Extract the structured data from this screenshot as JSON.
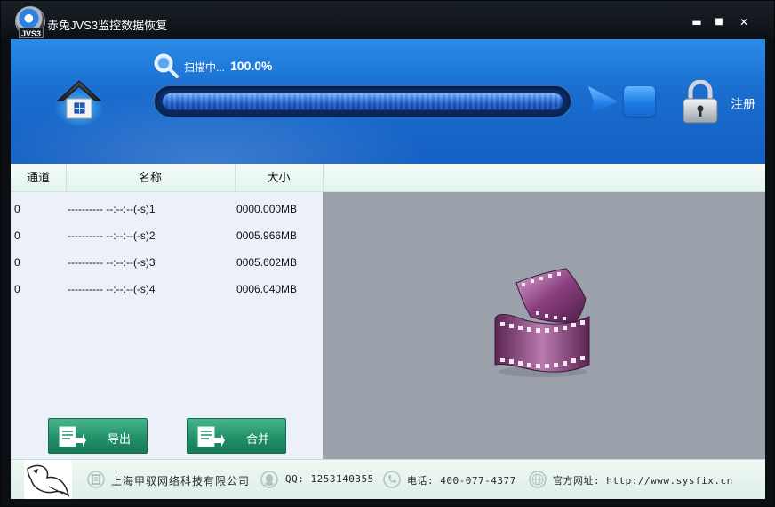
{
  "window": {
    "title": "赤兔JVS3监控数据恢复",
    "logo_tag": "JVS3",
    "minimize": "▬",
    "maximize": "■",
    "close": "✕"
  },
  "scan": {
    "label": "扫描中...",
    "percent_text": "100.0%",
    "progress_fraction": 1.0
  },
  "header": {
    "register_label": "注册"
  },
  "list": {
    "columns": [
      "通道",
      "名称",
      "大小"
    ],
    "rows": [
      {
        "channel": "0",
        "name": "---------- --:--:--(-s)1",
        "size": "0000.000MB"
      },
      {
        "channel": "0",
        "name": "---------- --:--:--(-s)2",
        "size": "0005.966MB"
      },
      {
        "channel": "0",
        "name": "---------- --:--:--(-s)3",
        "size": "0005.602MB"
      },
      {
        "channel": "0",
        "name": "---------- --:--:--(-s)4",
        "size": "0006.040MB"
      }
    ]
  },
  "actions": {
    "export_label": "导出",
    "merge_label": "合并"
  },
  "footer": {
    "company": "上海甲驭网络科技有限公司",
    "qq": "QQ: 1253140355",
    "phone": "电话: 400-077-4377",
    "website": "官方网址: http://www.sysfix.cn"
  },
  "colors": {
    "header_blue": "#1a6ed0",
    "button_green": "#1f8e66",
    "preview_gray": "#9aa1aa"
  },
  "icons": {
    "home": "home-icon",
    "search": "search-icon",
    "play": "play-icon",
    "stop": "stop-icon",
    "lock": "lock-icon",
    "film": "film-reel-icon",
    "export": "export-icon",
    "merge": "merge-icon"
  }
}
